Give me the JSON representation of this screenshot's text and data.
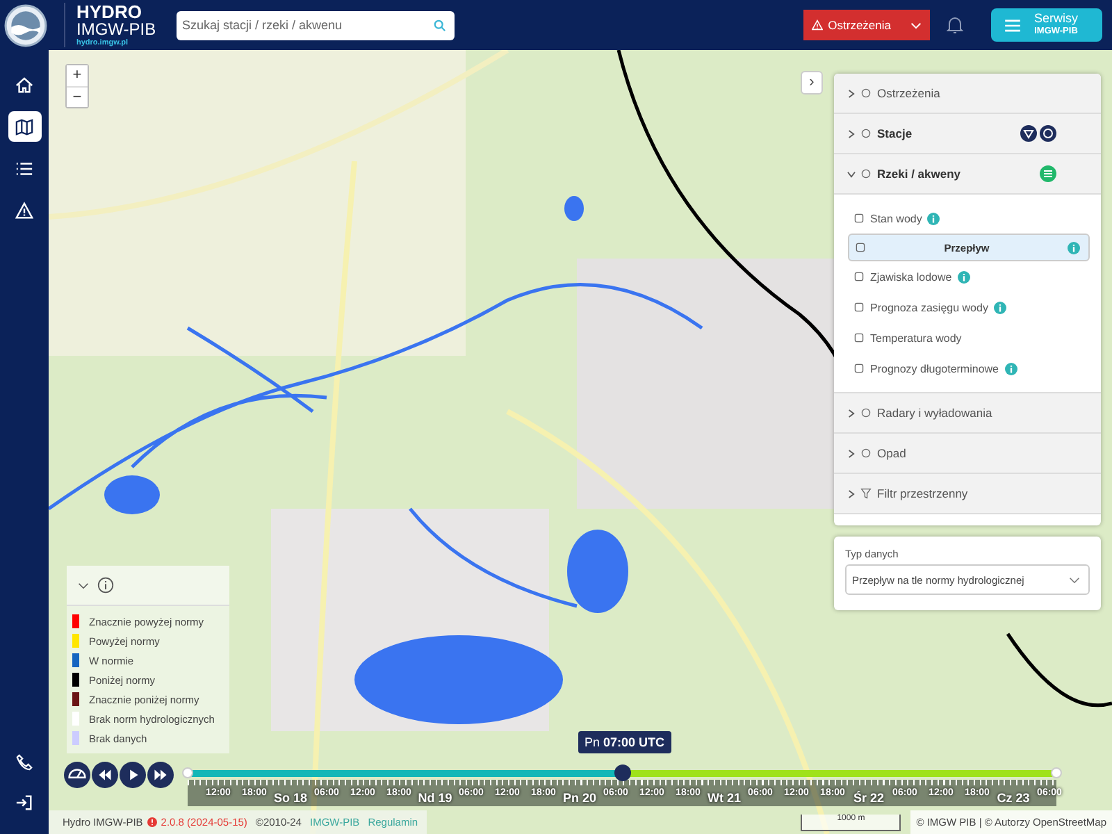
{
  "header": {
    "logo_title": "HYDRO",
    "logo_subtitle": "IMGW-PIB",
    "logo_url": "hydro.imgw.pl",
    "search": {
      "placeholder": "Szukaj stacji / rzeki / akwenu"
    },
    "warnings_button": "Ostrzeżenia",
    "services_button": {
      "title": "Serwisy",
      "subtitle": "IMGW-PIB"
    }
  },
  "sidebar": {
    "items": [
      {
        "selected": false
      },
      {
        "selected": true
      },
      {
        "selected": false
      },
      {
        "selected": false
      }
    ]
  },
  "map": {
    "zoom_in": "+",
    "zoom_out": "−",
    "collapse": "›"
  },
  "panel": {
    "sections": [
      {
        "label": "Ostrzeżenia",
        "expanded": false,
        "active": false
      },
      {
        "label": "Stacje",
        "expanded": false,
        "active": true
      },
      {
        "label": "Rzeki / akweny",
        "expanded": true,
        "active": true,
        "children": [
          {
            "label": "Stan wody",
            "selected": false,
            "info": true
          },
          {
            "label": "Przepływ",
            "selected": true,
            "info": true
          },
          {
            "label": "Zjawiska lodowe",
            "selected": false,
            "info": true
          },
          {
            "label": "Prognoza zasięgu wody",
            "selected": false,
            "info": true
          },
          {
            "label": "Temperatura wody",
            "selected": false,
            "info": false
          },
          {
            "label": "Prognozy długoterminowe",
            "selected": false,
            "info": true
          }
        ]
      },
      {
        "label": "Radary i wyładowania",
        "expanded": false,
        "active": false
      },
      {
        "label": "Opad",
        "expanded": false,
        "active": false
      },
      {
        "label": "Filtr przestrzenny",
        "expanded": false,
        "active": false
      }
    ]
  },
  "data_type": {
    "label": "Typ danych",
    "value": "Przepływ na tle normy hydrologicznej"
  },
  "legend": {
    "expanded": true,
    "items": [
      {
        "label": "Znacznie powyżej normy",
        "color": "#ff0000"
      },
      {
        "label": "Powyżej normy",
        "color": "#ffe600"
      },
      {
        "label": "W normie",
        "color": "#1565c0"
      },
      {
        "label": "Poniżej normy",
        "color": "#000000"
      },
      {
        "label": "Znacznie poniżej normy",
        "color": "#6b1414"
      },
      {
        "label": "Brak norm hydrologicznych",
        "color": "#ffffff"
      },
      {
        "label": "Brak danych",
        "color": "#ccccff"
      }
    ]
  },
  "timeline": {
    "tooltip": "Pn **07:00 UTC**",
    "level": 0.5,
    "labels": [
      {
        "text": "12:00",
        "kind": "time"
      },
      {
        "text": "18:00",
        "kind": "time"
      },
      {
        "text": "So 18",
        "kind": "day"
      },
      {
        "text": "06:00",
        "kind": "time"
      },
      {
        "text": "12:00",
        "kind": "time"
      },
      {
        "text": "18:00",
        "kind": "time"
      },
      {
        "text": "Nd 19",
        "kind": "day"
      },
      {
        "text": "06:00",
        "kind": "time"
      },
      {
        "text": "12:00",
        "kind": "time"
      },
      {
        "text": "18:00",
        "kind": "time"
      },
      {
        "text": "Pn 20",
        "kind": "day"
      },
      {
        "text": "06:00",
        "kind": "time"
      },
      {
        "text": "12:00",
        "kind": "time"
      },
      {
        "text": "18:00",
        "kind": "time"
      },
      {
        "text": "Wt 21",
        "kind": "day"
      },
      {
        "text": "06:00",
        "kind": "time"
      },
      {
        "text": "12:00",
        "kind": "time"
      },
      {
        "text": "18:00",
        "kind": "time"
      },
      {
        "text": "Śr 22",
        "kind": "day"
      },
      {
        "text": "06:00",
        "kind": "time"
      },
      {
        "text": "12:00",
        "kind": "time"
      },
      {
        "text": "18:00",
        "kind": "time"
      },
      {
        "text": "Cz 23",
        "kind": "day"
      },
      {
        "text": "06:00",
        "kind": "time"
      }
    ]
  },
  "footer": {
    "app": "Hydro IMGW-PIB",
    "version": "2.0.8 (2024-05-15)",
    "copyright": "©2010-24",
    "link": "IMGW-PIB",
    "terms": "Regulamin",
    "scale": "1000 m",
    "attribution": "© IMGW PIB | © Autorzy OpenStreetMap"
  }
}
